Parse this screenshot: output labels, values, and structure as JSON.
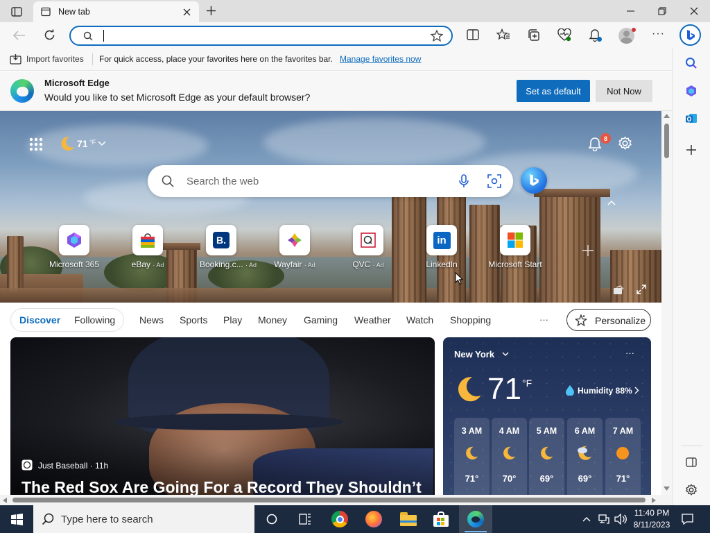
{
  "browser": {
    "tab_title": "New tab",
    "address_value": "",
    "favorites_bar": {
      "import_label": "Import favorites",
      "message": "For quick access, place your favorites here on the favorites bar.",
      "manage_link": "Manage favorites now"
    },
    "default_banner": {
      "title": "Microsoft Edge",
      "message": "Would you like to set Microsoft Edge as your default browser?",
      "primary_button": "Set as default",
      "secondary_button": "Not Now"
    }
  },
  "newtab": {
    "weather_temp": "71",
    "weather_unit": "°F",
    "notification_count": "8",
    "search_placeholder": "Search the web",
    "quick_links": [
      {
        "label": "Microsoft 365",
        "ad": ""
      },
      {
        "label": "eBay",
        "ad": "· Ad"
      },
      {
        "label": "Booking.c...",
        "ad": "· Ad"
      },
      {
        "label": "Wayfair",
        "ad": "· Ad"
      },
      {
        "label": "QVC",
        "ad": "· Ad"
      },
      {
        "label": "LinkedIn",
        "ad": ""
      },
      {
        "label": "Microsoft Start",
        "ad": ""
      }
    ],
    "feed_tabs": [
      "Discover",
      "Following"
    ],
    "feed_nav": [
      "News",
      "Sports",
      "Play",
      "Money",
      "Gaming",
      "Weather",
      "Watch",
      "Shopping"
    ],
    "more_label": "···",
    "personalize_label": "Personalize",
    "main_story": {
      "source": "Just Baseball",
      "age": "· 11h",
      "headline": "The Red Sox Are Going For a Record They Shouldn’t"
    },
    "weather_card": {
      "city": "New York",
      "temp": "71",
      "unit": "°F",
      "humidity": "Humidity 88%",
      "hours": [
        {
          "time": "3 AM",
          "temp": "71°",
          "icon": "moon-icon"
        },
        {
          "time": "4 AM",
          "temp": "70°",
          "icon": "moon-icon"
        },
        {
          "time": "5 AM",
          "temp": "69°",
          "icon": "moon-icon"
        },
        {
          "time": "6 AM",
          "temp": "69°",
          "icon": "moon-cloud-icon"
        },
        {
          "time": "7 AM",
          "temp": "71°",
          "icon": "sun-icon"
        }
      ]
    }
  },
  "taskbar": {
    "search_placeholder": "Type here to search",
    "time": "11:40 PM",
    "date": "8/11/2023"
  },
  "colors": {
    "accent": "#0f6cbd",
    "taskbar": "#1c2a3f",
    "weather_card": "#243660"
  }
}
